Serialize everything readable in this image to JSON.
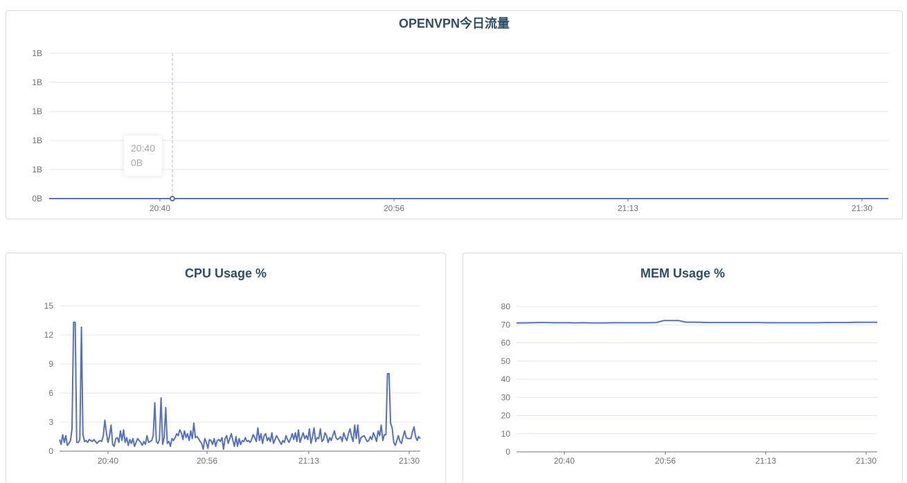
{
  "colors": {
    "line": "#5470c6",
    "grid": "#e0e6f1",
    "axis": "#6e7079",
    "title": "#2f4d67"
  },
  "traffic": {
    "title": "OPENVPN今日流量",
    "tooltip": {
      "time": "20:40",
      "value": "0B"
    }
  },
  "cpu": {
    "title": "CPU Usage %"
  },
  "mem": {
    "title": "MEM  Usage %"
  },
  "chart_data": [
    {
      "type": "line",
      "title": "OPENVPN今日流量",
      "y_tick_labels": [
        "0B",
        "1B",
        "1B",
        "1B",
        "1B",
        "1B"
      ],
      "ylim": [
        0,
        1
      ],
      "x_tick_labels": [
        "20:40",
        "20:56",
        "21:13",
        "21:30"
      ],
      "series": [
        {
          "values": [
            0,
            0,
            0,
            0,
            0,
            0,
            0,
            0,
            0,
            0,
            0,
            0,
            0,
            0,
            0,
            0,
            0,
            0,
            0,
            0,
            0,
            0,
            0,
            0
          ]
        }
      ],
      "highlight": {
        "x": "20:40",
        "value": "0B"
      },
      "grid": true
    },
    {
      "type": "line",
      "title": "CPU Usage %",
      "y_ticks": [
        0,
        3,
        6,
        9,
        12,
        15
      ],
      "ylim": [
        0,
        15
      ],
      "x_tick_labels": [
        "20:40",
        "20:56",
        "21:13",
        "21:30"
      ],
      "series": [
        {
          "values": [
            1.2,
            0.7,
            1.7,
            0.9,
            1.6,
            0.6,
            0.8,
            1.1,
            2.3,
            13.3,
            13.3,
            0.9,
            0.9,
            1.2,
            12.8,
            1.7,
            1.0,
            1.1,
            0.9,
            1.2,
            1.1,
            1.0,
            1.2,
            1.0,
            0.8,
            1.0,
            1.1,
            1.0,
            1.6,
            3.2,
            1.9,
            0.9,
            1.6,
            2.7,
            0.7,
            0.5,
            1.3,
            1.4,
            0.9,
            2.1,
            1.1,
            2.2,
            0.9,
            1.4,
            0.6,
            1.2,
            0.8,
            1.3,
            0.5,
            0.9,
            1.3,
            1.1,
            0.9,
            0.6,
            1.0,
            0.7,
            1.6,
            0.9,
            1.0,
            1.1,
            1.6,
            5.0,
            1.0,
            0.8,
            1.2,
            5.5,
            0.7,
            1.4,
            4.5,
            0.8,
            1.0,
            0.5,
            1.3,
            1.1,
            1.4,
            1.8,
            1.6,
            2.2,
            1.9,
            1.2,
            2.1,
            1.4,
            1.8,
            1.1,
            2.1,
            1.3,
            2.9,
            1.4,
            1.5,
            1.3,
            1.0,
            0.8,
            0.2,
            1.3,
            0.9,
            0.3,
            1.2,
            1.1,
            0.7,
            1.3,
            0.5,
            1.1,
            1.2,
            1.0,
            1.4,
            0.2,
            1.3,
            1.6,
            0.8,
            1.3,
            1.8,
            1.1,
            0.5,
            1.5,
            0.5,
            1.3,
            0.7,
            1.1,
            1.0,
            1.4,
            1.0,
            1.1,
            0.9,
            1.2,
            1.7,
            1.4,
            1.0,
            2.4,
            1.1,
            1.8,
            0.8,
            1.6,
            1.8,
            1.1,
            1.4,
            1.0,
            1.9,
            0.8,
            1.2,
            1.6,
            1.3,
            1.0,
            0.7,
            1.1,
            0.9,
            1.6,
            1.2,
            0.9,
            1.3,
            1.8,
            1.2,
            1.9,
            1.0,
            2.2,
            0.9,
            1.4,
            1.9,
            1.3,
            1.6,
            1.2,
            2.3,
            0.8,
            1.5,
            2.4,
            1.0,
            1.4,
            1.3,
            2.3,
            1.0,
            1.2,
            1.9,
            1.6,
            0.9,
            1.4,
            1.1,
            1.6,
            2.1,
            1.4,
            1.2,
            1.3,
            1.5,
            1.0,
            1.9,
            1.4,
            1.1,
            1.8,
            2.3,
            1.5,
            1.0,
            2.7,
            1.3,
            2.7,
            0.8,
            1.4,
            1.5,
            1.6,
            1.3,
            1.0,
            1.1,
            1.5,
            1.2,
            1.9,
            1.5,
            1.0,
            2.1,
            1.6,
            2.7,
            1.1,
            1.7,
            1.7,
            8.0,
            8.0,
            2.9,
            2.4,
            0.9,
            0.6,
            1.1,
            1.6,
            1.0,
            0.8,
            1.5,
            2.1,
            1.4,
            1.3,
            1.3,
            1.3,
            2.0,
            2.5,
            1.5,
            1.1,
            1.5,
            1.3
          ]
        }
      ],
      "grid": true
    },
    {
      "type": "line",
      "title": "MEM  Usage %",
      "y_ticks": [
        0,
        10,
        20,
        30,
        40,
        50,
        60,
        70,
        80
      ],
      "ylim": [
        0,
        80
      ],
      "x_tick_labels": [
        "20:40",
        "20:56",
        "21:13",
        "21:30"
      ],
      "series": [
        {
          "values": [
            71.0,
            71.0,
            71.1,
            71.2,
            71.2,
            71.1,
            71.1,
            71.1,
            71.0,
            71.1,
            71.0,
            71.0,
            71.0,
            71.1,
            71.1,
            71.1,
            71.1,
            71.1,
            71.1,
            71.2,
            72.3,
            72.3,
            72.3,
            71.4,
            71.4,
            71.3,
            71.2,
            71.2,
            71.2,
            71.2,
            71.2,
            71.2,
            71.2,
            71.2,
            71.1,
            71.1,
            71.1,
            71.1,
            71.1,
            71.1,
            71.1,
            71.1,
            71.2,
            71.2,
            71.2,
            71.2,
            71.3,
            71.3,
            71.3,
            71.3
          ]
        }
      ],
      "grid": true
    }
  ]
}
